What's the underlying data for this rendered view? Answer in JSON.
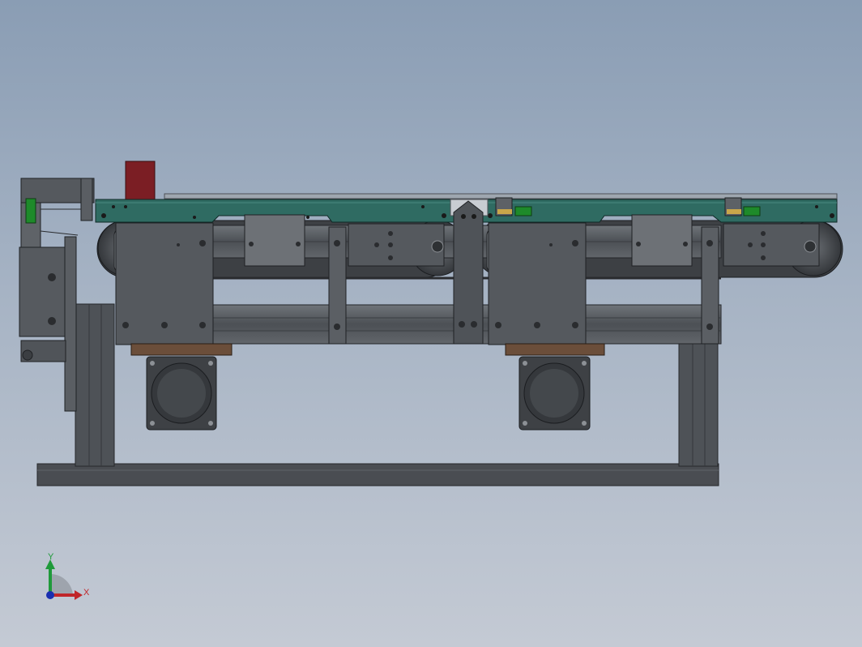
{
  "viewport": {
    "background_top": "#8a9db4",
    "background_bottom": "#c4cad4"
  },
  "colors": {
    "frame_dark": "#3f4246",
    "frame_mid": "#5b5f64",
    "frame_light": "#6e7378",
    "conveyor_green": "#2f6b62",
    "sensor_green": "#1e8a2a",
    "red_block": "#7b1e24",
    "motor_flange": "#6b4e3a"
  },
  "triad": {
    "x_label": "X",
    "y_label": "Y",
    "x_color": "#c0262a",
    "y_color": "#1f9a3a",
    "z_color": "#1a2fb0"
  }
}
